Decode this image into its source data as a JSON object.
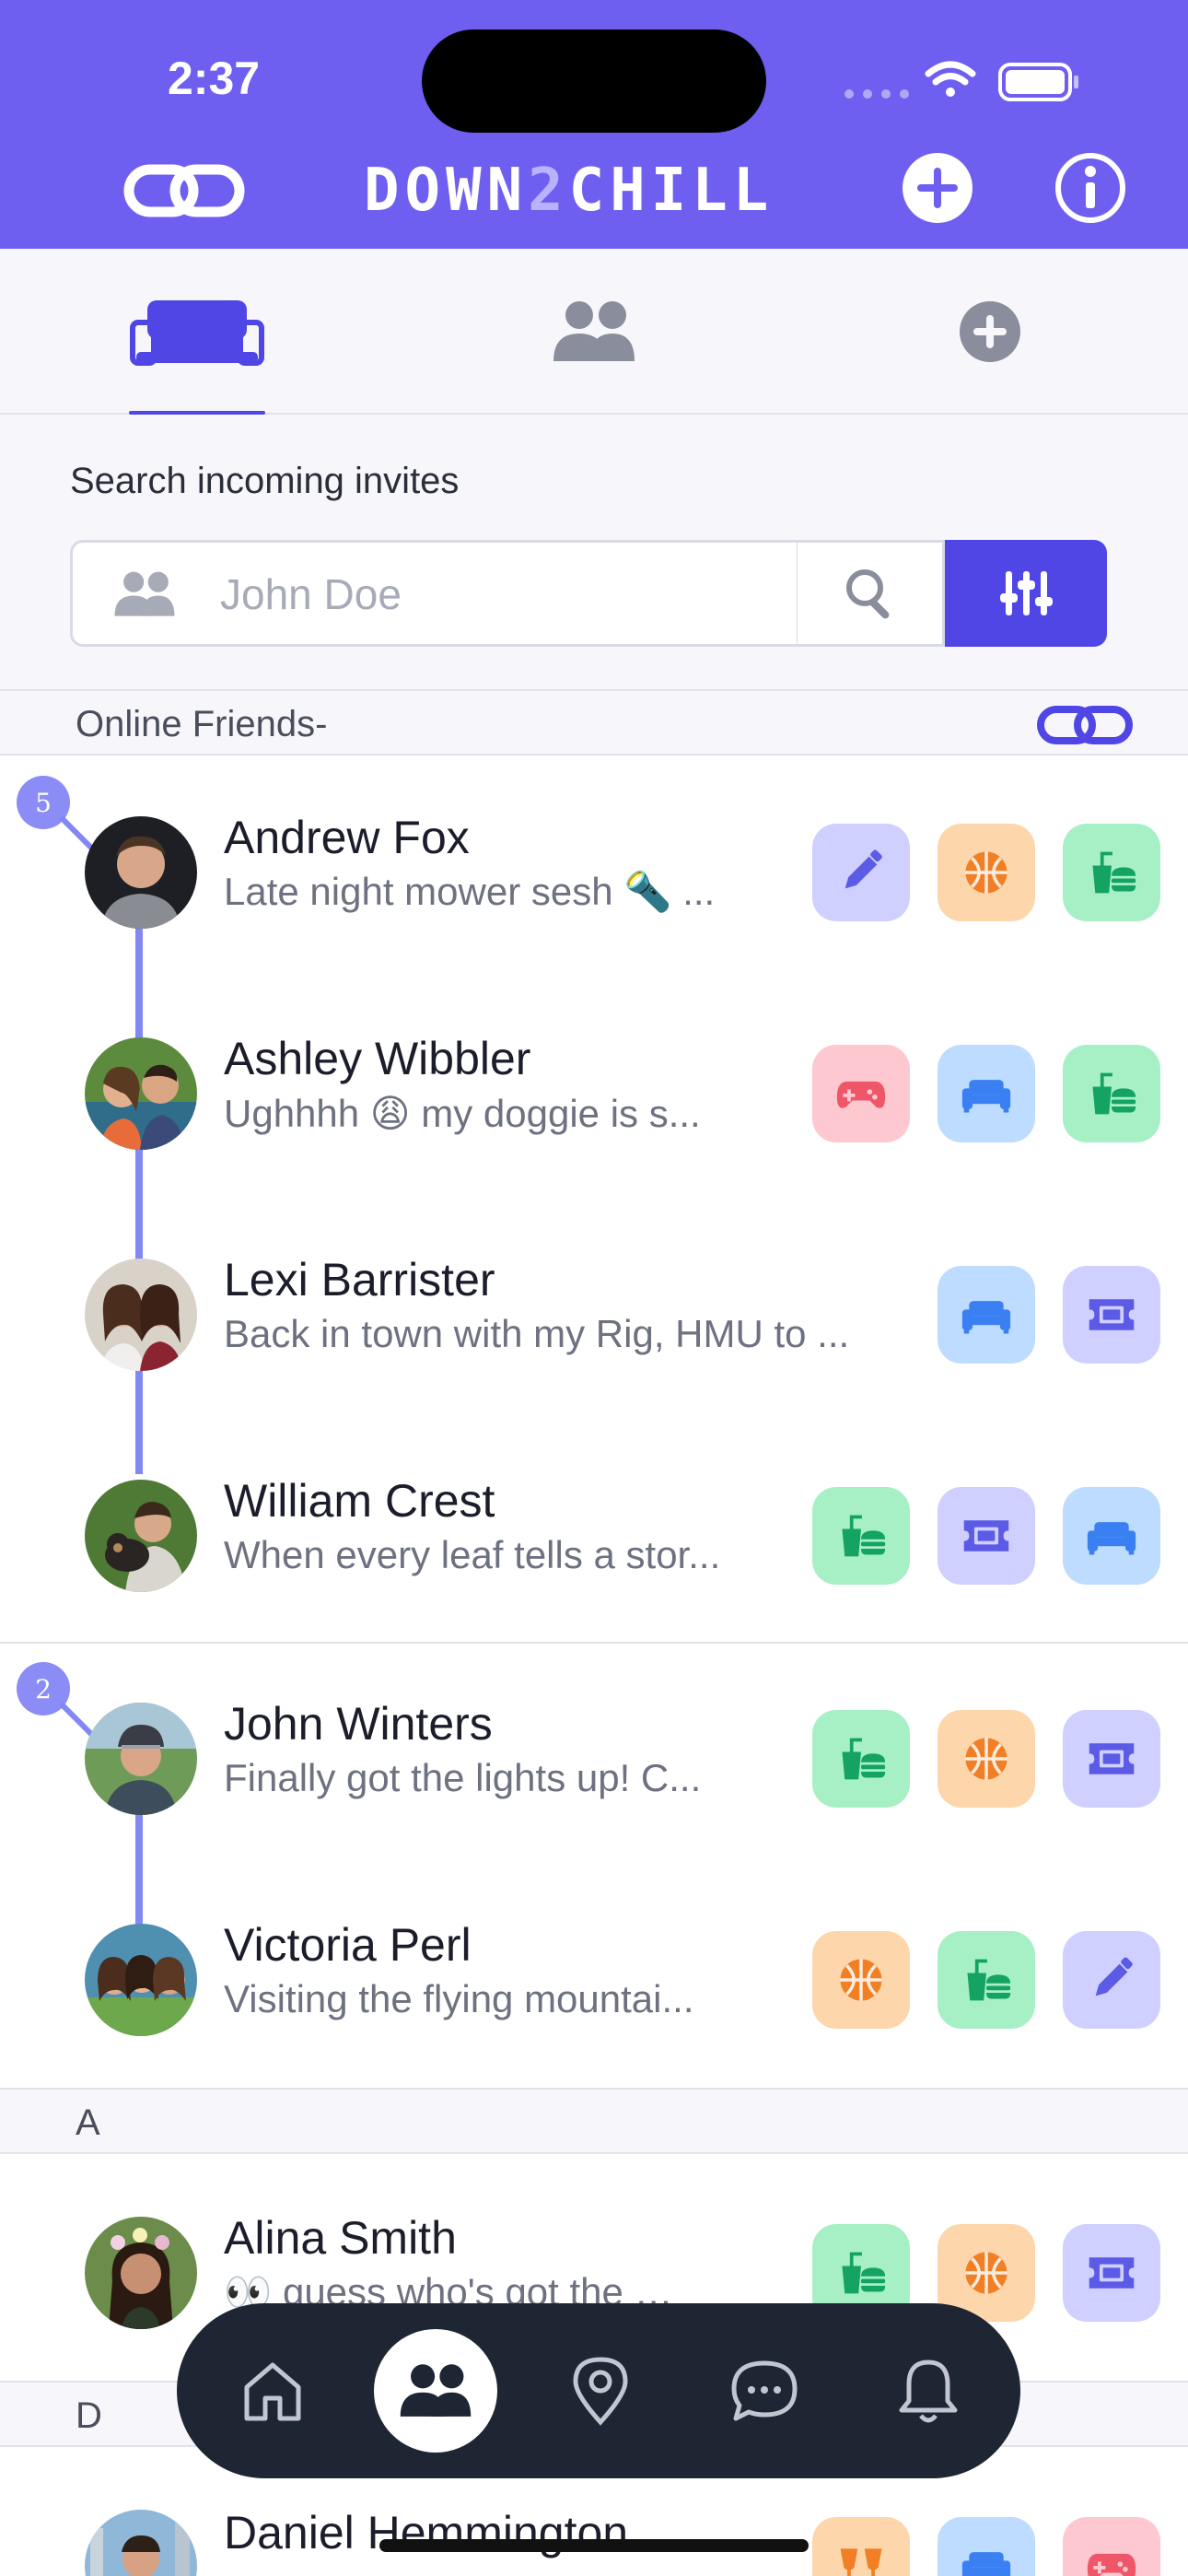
{
  "status_bar": {
    "time": "2:37"
  },
  "header": {
    "brand_pre": "DOWN",
    "brand_two": "2",
    "brand_post": "CHILL",
    "icons": [
      "link-icon",
      "plus-circle-icon",
      "info-icon"
    ]
  },
  "tabs": [
    {
      "icon": "couch-icon",
      "active": true
    },
    {
      "icon": "people-icon",
      "active": false
    },
    {
      "icon": "plus-circle-icon",
      "active": false
    }
  ],
  "search": {
    "label": "Search incoming invites",
    "placeholder": "John Doe"
  },
  "sections": {
    "online": "Online Friends-",
    "a": "A",
    "d": "D"
  },
  "groups": [
    {
      "badge": "5"
    },
    {
      "badge": "2"
    }
  ],
  "friends": [
    {
      "name": "Andrew Fox",
      "status": "Late night mower sesh 🔦 ...",
      "actions": [
        "pencil",
        "basketball",
        "food"
      ]
    },
    {
      "name": "Ashley Wibbler",
      "status": "Ughhhh 😩 my doggie is s...",
      "actions": [
        "gamepad",
        "couch",
        "food"
      ]
    },
    {
      "name": "Lexi Barrister",
      "status": "Back in town with my Rig, HMU to ...",
      "actions": [
        "couch",
        "ticket"
      ]
    },
    {
      "name": "William Crest",
      "status": "When every leaf tells a stor...",
      "actions": [
        "food",
        "ticket",
        "couch"
      ]
    },
    {
      "name": "John Winters",
      "status": "Finally got the lights up! C...",
      "actions": [
        "food",
        "basketball",
        "ticket"
      ]
    },
    {
      "name": "Victoria Perl",
      "status": "Visiting the flying mountai...",
      "actions": [
        "basketball",
        "food",
        "pencil"
      ]
    },
    {
      "name": "Alina Smith",
      "status": "👀 guess who's got the b...",
      "actions": [
        "food",
        "basketball",
        "ticket"
      ]
    },
    {
      "name": "Daniel Hemmington",
      "status": "",
      "actions": [
        "cheers",
        "couch",
        "gamepad"
      ]
    }
  ],
  "bottom_nav": [
    "home-icon",
    "people-icon",
    "location-pin-icon",
    "chat-icon",
    "bell-icon"
  ],
  "colors": {
    "brand": "#6f5ff0",
    "accent": "#4f46e5",
    "nav_bg": "#1e2533"
  }
}
